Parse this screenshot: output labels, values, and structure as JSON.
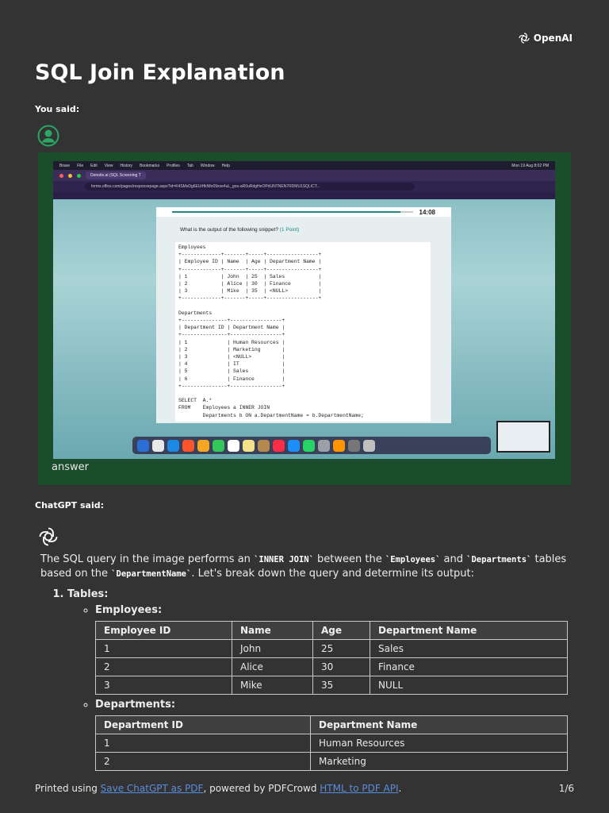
{
  "brand": {
    "name": "OpenAI"
  },
  "header": {
    "title": "SQL Join Explanation"
  },
  "user_message": {
    "role_label": "You said:",
    "text": "answer",
    "screenshot": {
      "menubar_items": [
        "Brave",
        "File",
        "Edit",
        "View",
        "History",
        "Bookmarks",
        "Profiles",
        "Tab",
        "Window",
        "Help"
      ],
      "clock": "Mon 19 Aug 8:02 PM",
      "tab_title": "Denotio.ai (SQL Screening T",
      "url": "forms.office.com/pages/responsepage.aspx?id=K4SMsDg6EUiHkNfo09xxe4uL_gou-aR0uRdgHeOPdUNTNEN7RDMU1SQLICT...",
      "timer": "14:08",
      "question_text": "What is the output of the following snippet?",
      "question_points": "(1 Point)",
      "progress": 0.95,
      "code": "Employees\n+-------------+-------+-----+-----------------+\n| Employee ID | Name  | Age | Department Name |\n+-------------+-------+-----+-----------------+\n| 1           | John  | 25  | Sales           |\n| 2           | Alice | 30  | Finance         |\n| 3           | Mike  | 35  | <NULL>          |\n+-------------+-------+-----+-----------------+\n\nDepartments\n+---------------+-----------------+\n| Department ID | Department Name |\n+---------------+-----------------+\n| 1             | Human Resources |\n| 2             | Marketing       |\n| 3             | <NULL>          |\n| 4             | IT              |\n| 5             | Sales           |\n| 6             | Finance         |\n+---------------+-----------------+\n\nSELECT  A.*\nFROM    Employees a INNER JOIN\n        Departments b ON a.DepartmentName = b.DepartmentName;"
    }
  },
  "assistant_message": {
    "role_label": "ChatGPT said:",
    "intro_1": "The SQL query in the image performs an ",
    "intro_code_1": "`INNER JOIN`",
    "intro_2": " between the ",
    "intro_code_2": "`Employees`",
    "intro_3": " and ",
    "intro_code_3": "`Departments`",
    "intro_4": " tables based on the ",
    "intro_code_4": "`DepartmentName`",
    "intro_5": ". Let's break down the query and determine its output:",
    "step_1_label": "Tables:",
    "employees_label": "Employees:",
    "employees_table": {
      "headers": [
        "Employee ID",
        "Name",
        "Age",
        "Department Name"
      ],
      "rows": [
        [
          "1",
          "John",
          "25",
          "Sales"
        ],
        [
          "2",
          "Alice",
          "30",
          "Finance"
        ],
        [
          "3",
          "Mike",
          "35",
          "NULL"
        ]
      ]
    },
    "departments_label": "Departments:",
    "departments_table": {
      "headers": [
        "Department ID",
        "Department Name"
      ],
      "rows": [
        [
          "1",
          "Human Resources"
        ],
        [
          "2",
          "Marketing"
        ]
      ]
    }
  },
  "footer": {
    "prefix": "Printed using ",
    "link_1": "Save ChatGPT as PDF",
    "middle": ", powered by PDFCrowd ",
    "link_2": "HTML to PDF API",
    "suffix": ".",
    "page": "1/6"
  },
  "colors": {
    "background": "#333333",
    "user_box": "#1b4c2c",
    "avatar_green": "#2aa665",
    "link": "#5b8dde"
  }
}
